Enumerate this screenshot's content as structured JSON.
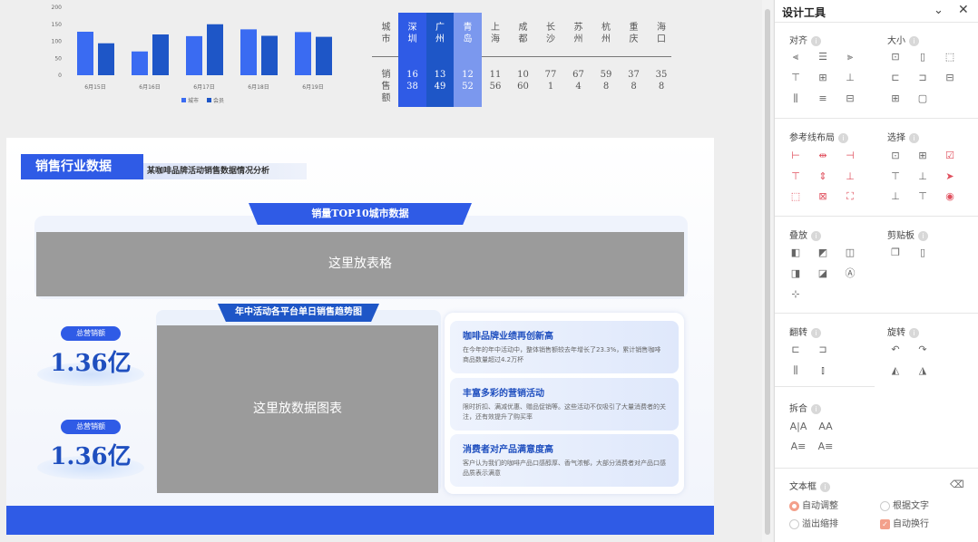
{
  "top_chart": {
    "chart_data": {
      "type": "bar",
      "categories": [
        "6月15日",
        "6月16日",
        "6月17日",
        "6月18日",
        "6月19日"
      ],
      "series": [
        {
          "name": "城市",
          "values": [
            128,
            70,
            115,
            135,
            127
          ],
          "color": "#3a6bf2"
        },
        {
          "name": "会员",
          "values": [
            94,
            120,
            150,
            116,
            113
          ],
          "color": "#1e56c7"
        }
      ],
      "ylim": [
        0,
        200
      ],
      "yticks": [
        0,
        50,
        100,
        150,
        200
      ],
      "legend": "bottom"
    }
  },
  "city_table": {
    "row_header_city": "城市",
    "row_header_sales": "销售额",
    "cities": [
      {
        "name": "深圳",
        "value": "1638",
        "color": "#2f5be6"
      },
      {
        "name": "广州",
        "value": "1349",
        "color": "#1e56c7"
      },
      {
        "name": "青岛",
        "value": "1252",
        "color": "#7b98ee"
      },
      {
        "name": "上海",
        "value": "1156"
      },
      {
        "name": "成都",
        "value": "1060"
      },
      {
        "name": "长沙",
        "value": "771"
      },
      {
        "name": "苏州",
        "value": "674"
      },
      {
        "name": "杭州",
        "value": "598"
      },
      {
        "name": "重庆",
        "value": "378"
      },
      {
        "name": "海口",
        "value": "358"
      }
    ]
  },
  "slide": {
    "title": "销售行业数据",
    "subtitle": "某咖啡品牌活动销售数据情况分析",
    "top_ribbon": "销量TOP10城市数据",
    "table_placeholder": "这里放表格",
    "chart_ribbon": "年中活动各平台单日销售趋势图",
    "chart_placeholder": "这里放数据图表",
    "kpis": [
      {
        "label": "总营销额",
        "value": "1.36亿"
      },
      {
        "label": "总营销额",
        "value": "1.36亿"
      }
    ],
    "insights": [
      {
        "heading": "咖啡品牌业绩再创新高",
        "body": "在今年的年中活动中，整体销售额较去年增长了23.3%，累计销售咖啡商品数量超过4.2万杯"
      },
      {
        "heading": "丰富多彩的营销活动",
        "body": "限时折扣、满减优惠、赠品促销等。这些活动不仅吸引了大量消费者的关注，还有效提升了购买率"
      },
      {
        "heading": "消费者对产品满意度高",
        "body": "客户认为我们的咖啡产品口感醇厚、香气浓郁，大部分消费者对产品口感品质表示满意"
      }
    ]
  },
  "tool_panel": {
    "title": "设计工具",
    "sections": {
      "align": "对齐",
      "size": "大小",
      "guides": "参考线布局",
      "select": "选择",
      "layers": "叠放",
      "clipboard": "剪贴板",
      "flip": "翻转",
      "rotate": "旋转",
      "combine": "拆合",
      "textbox": "文本框"
    },
    "textbox_options": {
      "auto_adjust": "自动调整",
      "fit_text": "根据文字",
      "overflow": "溢出缩排",
      "auto_wrap": "自动换行"
    },
    "accent_color": "#e0505e"
  }
}
